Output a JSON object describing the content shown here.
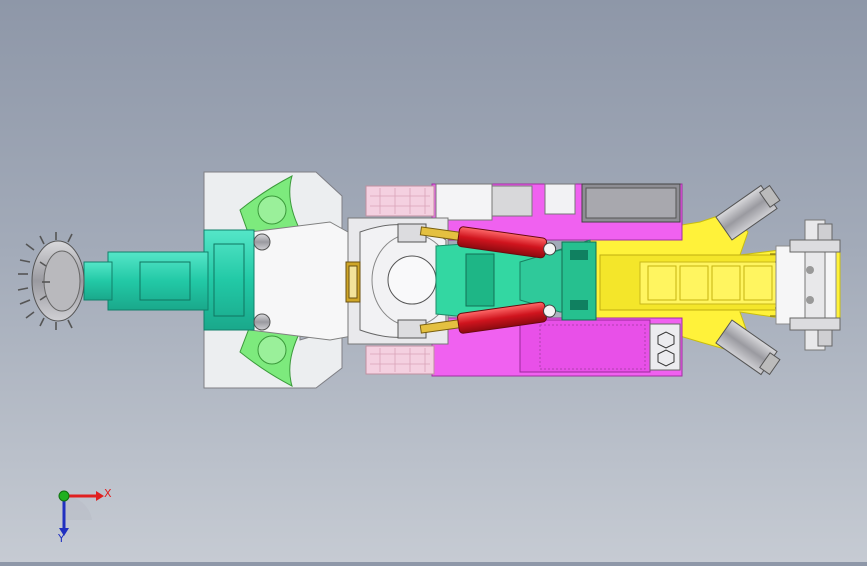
{
  "viewport": {
    "colors": {
      "background_top": "#8e97a8",
      "background_bottom": "#c6cbd3",
      "cutter_teal": "#2fd3b0",
      "cylinder_red": "#e0202a",
      "magenta_body": "#f061f0",
      "yellow_conveyor": "#fff23a",
      "green_plate": "#7dea7d",
      "pink_panel": "#f4d0e0",
      "light_grey": "#e9ecef"
    }
  },
  "triad": {
    "x_label": "X",
    "y_label": "Y",
    "colors": {
      "x": "#e02020",
      "y": "#20b020",
      "z": "#2030c0"
    }
  }
}
